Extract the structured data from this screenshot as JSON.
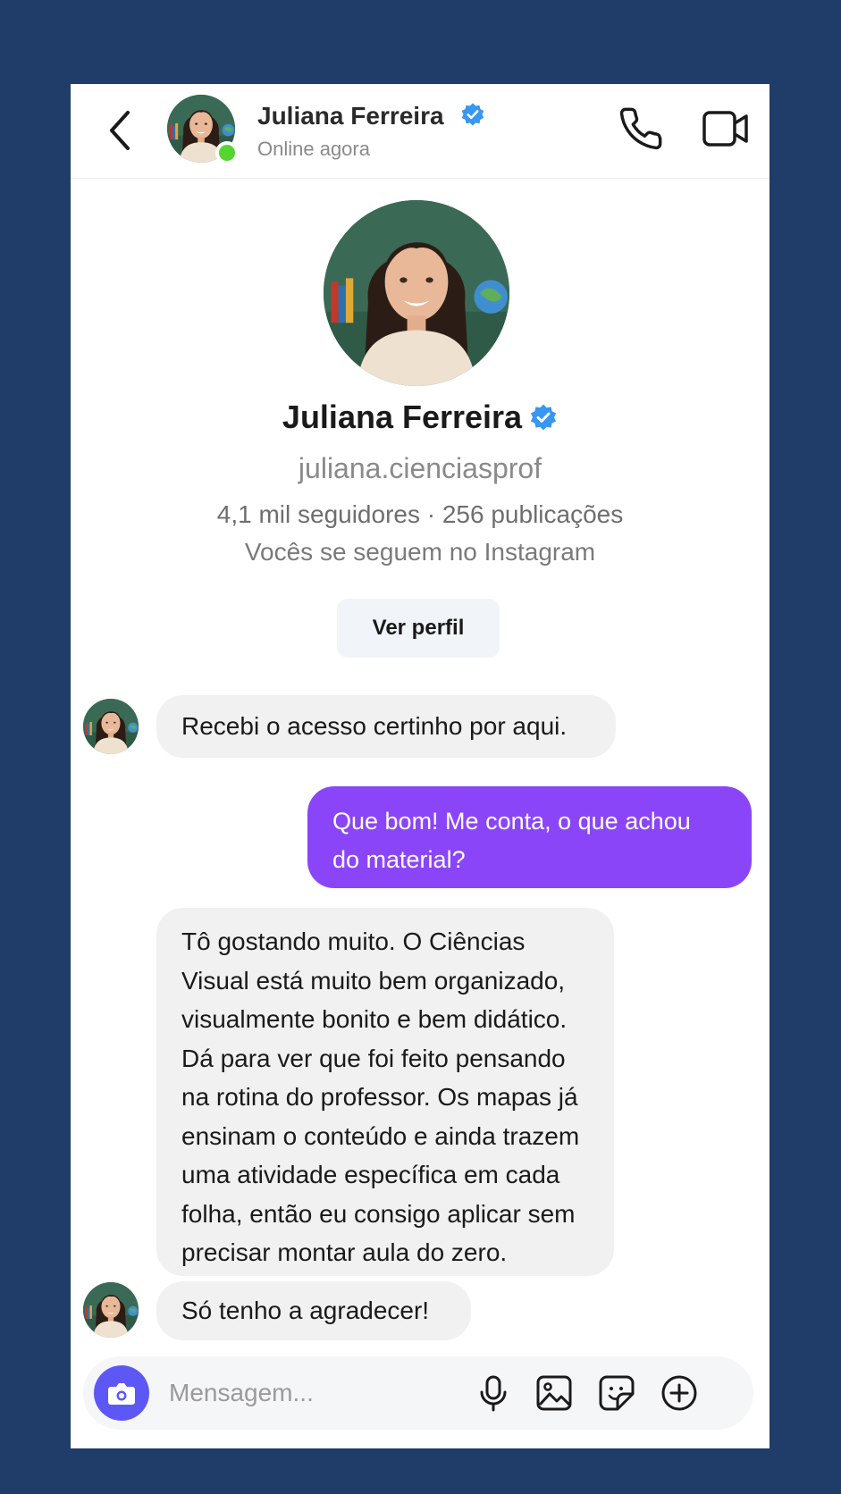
{
  "header": {
    "name": "Juliana Ferreira",
    "status": "Online agora"
  },
  "profile": {
    "name": "Juliana Ferreira",
    "handle": "juliana.cienciasprof",
    "stats": "4,1 mil seguidores · 256 publicações",
    "mutual": "Vocês se seguem no Instagram",
    "view_profile_label": "Ver perfil"
  },
  "messages": [
    {
      "from": "them",
      "text": "Recebi o acesso certinho por aqui."
    },
    {
      "from": "me",
      "lines": [
        "Que bom! Me conta, o que achou",
        "do material?"
      ]
    },
    {
      "from": "them",
      "lines": [
        "Tô gostando muito. O Ciências",
        "Visual está muito bem organizado,",
        "visualmente bonito e bem didático.",
        "Dá para ver que foi feito pensando",
        "na rotina do professor. Os mapas já",
        "ensinam o conteúdo e ainda trazem",
        "uma atividade específica em cada",
        "folha, então eu consigo aplicar sem",
        "precisar montar aula do zero."
      ]
    },
    {
      "from": "them",
      "text": "Só tenho a agradecer!"
    }
  ],
  "composer": {
    "placeholder": "Mensagem..."
  },
  "colors": {
    "background": "#1f3d68",
    "outgoing_bubble": "#8a45f8",
    "incoming_bubble": "#f1f1f1",
    "online": "#55d62e",
    "verified": "#3897f0",
    "camera": "#5d58f5"
  },
  "icons": [
    "back-arrow-icon",
    "verified-badge-icon",
    "phone-icon",
    "video-camera-icon",
    "camera-icon",
    "microphone-icon",
    "gallery-icon",
    "sticker-icon",
    "plus-circle-icon"
  ]
}
